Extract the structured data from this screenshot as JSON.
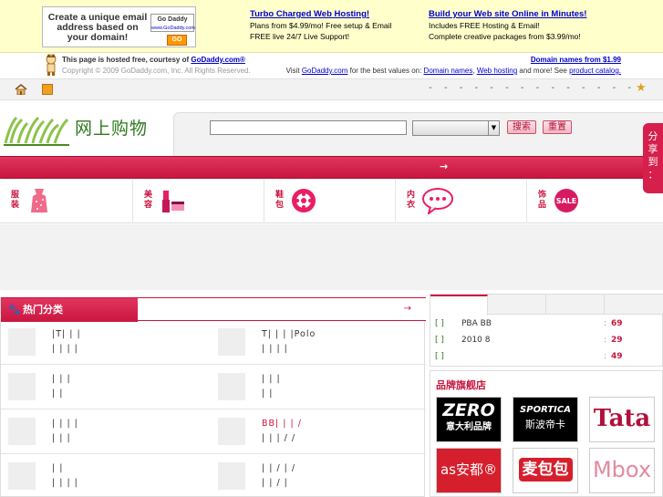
{
  "godaddy": {
    "ad_text": "Create a unique email address based on your domain!",
    "logo_text": "Go Daddy",
    "logo_url": "www.GoDaddy.com",
    "go_label": "GO",
    "col1": {
      "head": "Turbo Charged Web Hosting!",
      "line1": "Plans from $4.99/mo! Free setup & Email",
      "line2": "FREE live 24/7 Live Support!"
    },
    "col2": {
      "head": "Build your Web site Online in Minutes!",
      "line1": "Includes FREE Hosting & Email!",
      "line2": "Complete creative packages from $3.99/mo!"
    }
  },
  "hosted": {
    "line1_prefix": "This page is hosted free, courtesy of ",
    "line1_link": "GoDaddy.com®",
    "line2": "Copyright © 2009 GoDaddy.com, Inc. All Rights Reserved.",
    "right1": "Domain names from $1.99",
    "right2_prefix": "Visit ",
    "right2_link1": "GoDaddy.com",
    "right2_mid": " for the best values on: ",
    "right2_link2": "Domain names",
    "right2_sep": ", ",
    "right2_link3": "Web hosting",
    "right2_tail": " and more! See ",
    "right2_link4": "product catalog."
  },
  "toolbar": {
    "dashes": "- - - - - - - - - - - - - -"
  },
  "header": {
    "logo_text": "网上购物",
    "search_placeholder": "",
    "search_button": "搜索",
    "reset_button": "重置"
  },
  "share_label": "分享到：",
  "nav_arrow": "→",
  "categories": [
    {
      "label": "服装"
    },
    {
      "label": "美容"
    },
    {
      "label": "鞋包"
    },
    {
      "label": "内衣"
    },
    {
      "label": "饰品"
    }
  ],
  "hot": {
    "title": "热门分类",
    "more": "→",
    "rows": [
      {
        "left": {
          "l1": "|T|  |  |",
          "l2": "|  |  |  |"
        },
        "right": {
          "l1": "T|  |  |  |Polo",
          "l2": "|  |  |  |"
        }
      },
      {
        "left": {
          "l1": "|  |  |",
          "l2": "|  |"
        },
        "right": {
          "l1": "|  |  |",
          "l2": "|  |"
        }
      },
      {
        "left": {
          "l1": "|  |  |  |",
          "l2": "|  |  |"
        },
        "right": {
          "l1": "BB|  |  | /",
          "l2": "|  |  | / /"
        }
      },
      {
        "left": {
          "l1": "|  |",
          "l2": "|  |  |  |"
        },
        "right": {
          "l1": "|  |  / |  /",
          "l2": "|  |  /  |"
        }
      }
    ]
  },
  "news": {
    "rows": [
      {
        "bracket": "[ ]",
        "text": "PBA    BB",
        "colon": ":",
        "num": "69"
      },
      {
        "bracket": "[ ]",
        "text": "2010         8",
        "colon": ":",
        "num": "29"
      },
      {
        "bracket": "[ ]",
        "text": "",
        "colon": ":",
        "num": "49"
      }
    ]
  },
  "brands": {
    "title": "品牌旗舰店",
    "items": [
      {
        "name": "ZERO",
        "sub": "意大利品牌"
      },
      {
        "name": "SPORTICA",
        "sub": "斯波帝卡"
      },
      {
        "name": "Tata",
        "sub": ""
      },
      {
        "name": "as安都®",
        "sub": ""
      },
      {
        "name": "麦包包",
        "sub": ""
      },
      {
        "name": "Mbox",
        "sub": ""
      }
    ]
  },
  "colors": {
    "accent": "#c8163e",
    "banner_bg": "#ffffcc",
    "logo_green": "#2e7a1e"
  }
}
